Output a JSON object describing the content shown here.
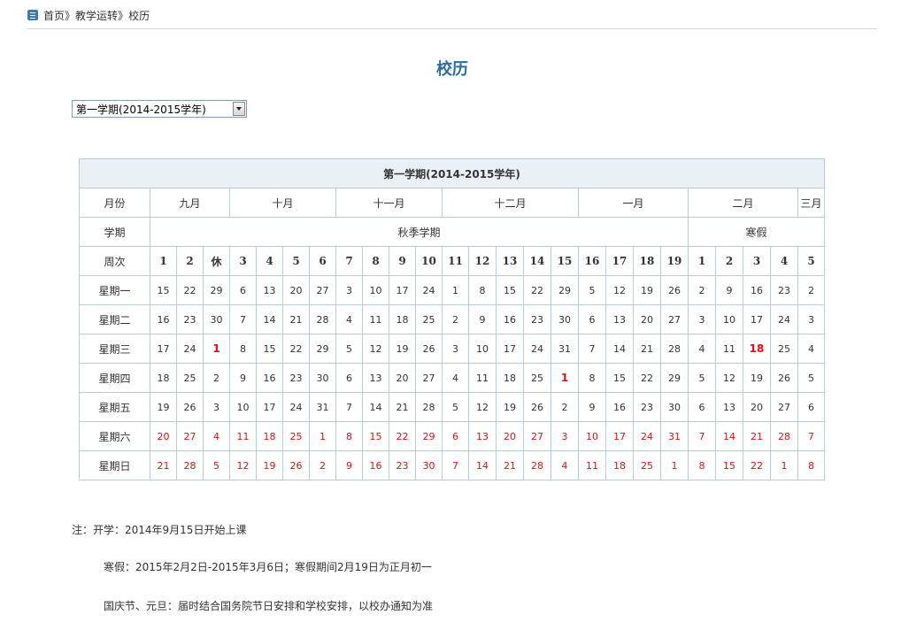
{
  "breadcrumb": {
    "items": [
      "首页",
      "教学运转",
      "校历"
    ],
    "separator": "》"
  },
  "page_title": "校历",
  "semester_select": {
    "value": "第一学期(2014-2015学年)"
  },
  "calendar": {
    "title": "第一学期(2014-2015学年)",
    "month_label": "月份",
    "months": [
      {
        "name": "九月",
        "span": 3
      },
      {
        "name": "十月",
        "span": 4
      },
      {
        "name": "十一月",
        "span": 4
      },
      {
        "name": "十二月",
        "span": 5
      },
      {
        "name": "一月",
        "span": 4
      },
      {
        "name": "二月",
        "span": 4
      },
      {
        "name": "三月",
        "span": 1
      }
    ],
    "term_label": "学期",
    "terms": [
      {
        "name": "秋季学期",
        "span": 20
      },
      {
        "name": "寒假",
        "span": 5
      }
    ],
    "week_label": "周次",
    "weeks": [
      "1",
      "2",
      "休",
      "3",
      "4",
      "5",
      "6",
      "7",
      "8",
      "9",
      "10",
      "11",
      "12",
      "13",
      "14",
      "15",
      "16",
      "17",
      "18",
      "19",
      "1",
      "2",
      "3",
      "4",
      "5"
    ],
    "days": [
      {
        "label": "星期一",
        "values": [
          "15",
          "22",
          "29",
          "6",
          "13",
          "20",
          "27",
          "3",
          "10",
          "17",
          "24",
          "1",
          "8",
          "15",
          "22",
          "29",
          "5",
          "12",
          "19",
          "26",
          "2",
          "9",
          "16",
          "23",
          "2"
        ],
        "weekend": false
      },
      {
        "label": "星期二",
        "values": [
          "16",
          "23",
          "30",
          "7",
          "14",
          "21",
          "28",
          "4",
          "11",
          "18",
          "25",
          "2",
          "9",
          "16",
          "23",
          "30",
          "6",
          "13",
          "20",
          "27",
          "3",
          "10",
          "17",
          "24",
          "3"
        ],
        "weekend": false
      },
      {
        "label": "星期三",
        "values": [
          "17",
          "24",
          "1",
          "8",
          "15",
          "22",
          "29",
          "5",
          "12",
          "19",
          "26",
          "3",
          "10",
          "17",
          "24",
          "31",
          "7",
          "14",
          "21",
          "28",
          "4",
          "11",
          "18",
          "25",
          "4"
        ],
        "weekend": false
      },
      {
        "label": "星期四",
        "values": [
          "18",
          "25",
          "2",
          "9",
          "16",
          "23",
          "30",
          "6",
          "13",
          "20",
          "27",
          "4",
          "11",
          "18",
          "25",
          "1",
          "8",
          "15",
          "22",
          "29",
          "5",
          "12",
          "19",
          "26",
          "5"
        ],
        "weekend": false
      },
      {
        "label": "星期五",
        "values": [
          "19",
          "26",
          "3",
          "10",
          "17",
          "24",
          "31",
          "7",
          "14",
          "21",
          "28",
          "5",
          "12",
          "19",
          "26",
          "2",
          "9",
          "16",
          "23",
          "30",
          "6",
          "13",
          "20",
          "27",
          "6"
        ],
        "weekend": false
      },
      {
        "label": "星期六",
        "values": [
          "20",
          "27",
          "4",
          "11",
          "18",
          "25",
          "1",
          "8",
          "15",
          "22",
          "29",
          "6",
          "13",
          "20",
          "27",
          "3",
          "10",
          "17",
          "24",
          "31",
          "7",
          "14",
          "21",
          "28",
          "7"
        ],
        "weekend": true
      },
      {
        "label": "星期日",
        "values": [
          "21",
          "28",
          "5",
          "12",
          "19",
          "26",
          "2",
          "9",
          "16",
          "23",
          "30",
          "7",
          "14",
          "21",
          "28",
          "4",
          "11",
          "18",
          "25",
          "1",
          "8",
          "15",
          "22",
          "1",
          "8"
        ],
        "weekend": true
      }
    ],
    "highlights": [
      {
        "row": 2,
        "col": 2
      },
      {
        "row": 3,
        "col": 15
      },
      {
        "row": 2,
        "col": 22
      }
    ],
    "colors": {
      "header_bg": "#e9f0f6",
      "border": "#b7cbd8",
      "weekend": "#d11",
      "title": "#2b6aa8"
    }
  },
  "notes": [
    "注：开学：2014年9月15日开始上课",
    "寒假：2015年2月2日-2015年3月6日；寒假期间2月19日为正月初一",
    "国庆节、元旦：届时结合国务院节日安排和学校安排，以校办通知为准"
  ]
}
